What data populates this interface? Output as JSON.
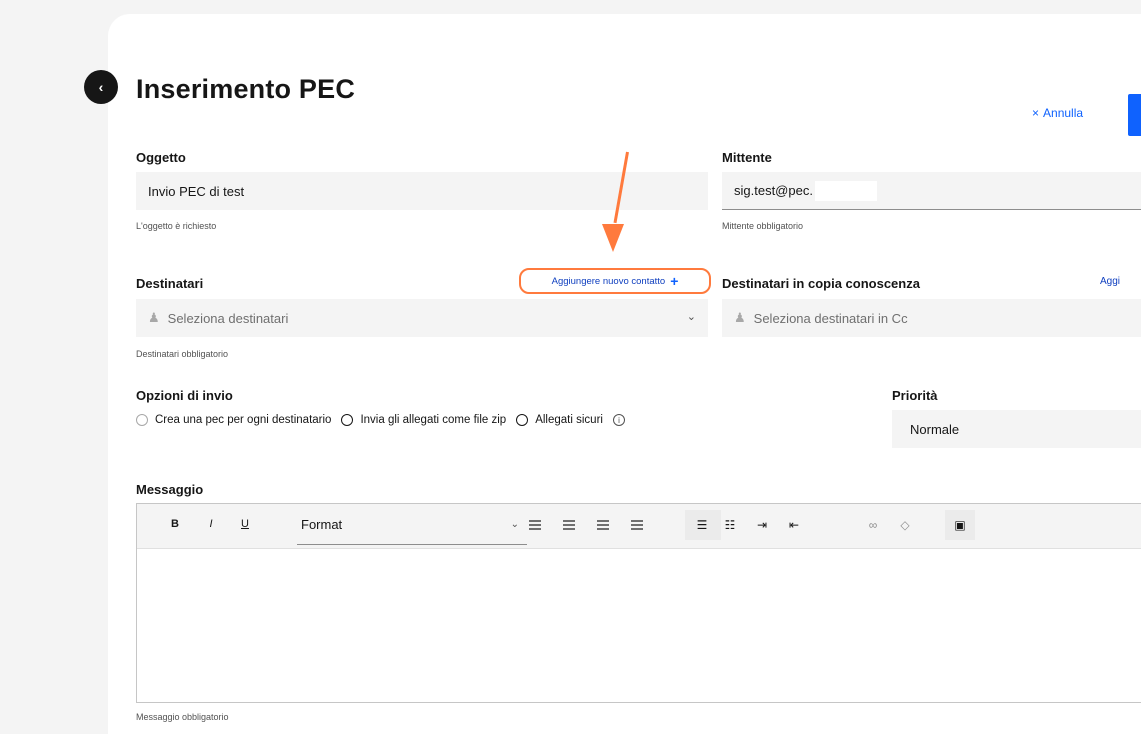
{
  "header": {
    "title": "Inserimento PEC",
    "cancel_label": "Annulla",
    "cancel_icon": "×"
  },
  "form": {
    "oggetto": {
      "label": "Oggetto",
      "value": "Invio PEC di test",
      "helper": "L'oggetto è richiesto"
    },
    "mittente": {
      "label": "Mittente",
      "value": "sig.test@pec.",
      "helper": "Mittente obbligatorio"
    },
    "destinatari": {
      "label": "Destinatari",
      "add_contact_label": "Aggiungere nuovo contatto",
      "placeholder": "Seleziona destinatari",
      "helper": "Destinatari obbligatorio"
    },
    "destinatari_cc": {
      "label": "Destinatari in copia conoscenza",
      "add_label": "Aggi",
      "placeholder": "Seleziona destinatari in Cc"
    },
    "opzioni": {
      "label": "Opzioni di invio",
      "options": [
        "Crea una pec per ogni destinatario",
        "Invia gli allegati come file zip",
        "Allegati sicuri"
      ]
    },
    "priorita": {
      "label": "Priorità",
      "value": "Normale"
    },
    "messaggio": {
      "label": "Messaggio",
      "helper": "Messaggio obbligatorio",
      "toolbar": {
        "bold": "B",
        "italic": "I",
        "underline": "U",
        "format": "Format"
      }
    }
  },
  "colors": {
    "accent": "#0f62fe",
    "annotation": "#ff7a3d"
  }
}
